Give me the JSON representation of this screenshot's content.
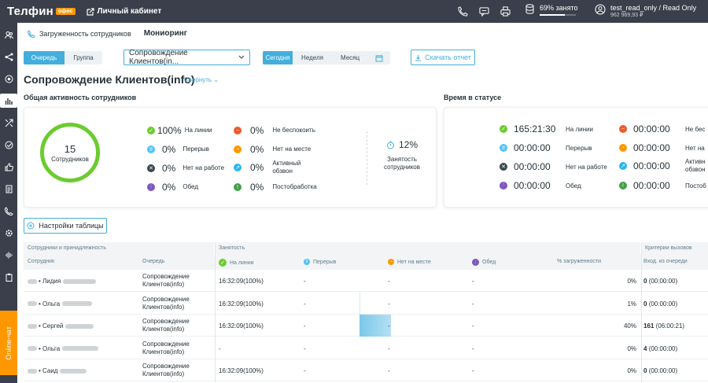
{
  "colors": {
    "accent": "#43aedc",
    "green": "#6ccb2f",
    "orange": "#ff9800",
    "red": "#f0592a",
    "topbar": "#3a3f4b"
  },
  "topbar": {
    "logo": "Телфин",
    "logo_badge": "офис",
    "cabinet_label": "Личный кабинет",
    "load_label": "69% занято",
    "load_fraction": 0.69,
    "user_name": "test_read_only / Read Only",
    "user_balance": "962 969,93 ₽",
    "icons": [
      "phone-icon",
      "chat-icon",
      "printer-icon",
      "database-icon",
      "user-circle-icon"
    ]
  },
  "sidebar": {
    "icons": [
      "users-icon",
      "flow-icon",
      "target-icon",
      "chart-icon",
      "routes-icon",
      "check-circle-icon",
      "thumb-icon",
      "document-icon",
      "phone-call-icon",
      "settings-icon",
      "waveform-icon",
      "clipboard-icon"
    ],
    "online_chat": "Online-чат"
  },
  "subnav": {
    "item1": "Загруженность сотрудников",
    "item2": "Мониоринг"
  },
  "filters": {
    "queue_tab": "Очередь",
    "group_tab": "Группа",
    "select_value": "Сопровождение Клиентов(in...",
    "today": "Сегодня",
    "week": "Неделя",
    "month": "Месяц",
    "download": "Скачать отчет"
  },
  "page": {
    "title": "Сопровождение Клиентов(info)",
    "collapse": "Свернуть"
  },
  "activity": {
    "title": "Общая активность сотрудников",
    "count": "15",
    "count_label": "Сотрудников",
    "stats": [
      {
        "pct": "100%",
        "label": "На линии"
      },
      {
        "pct": "0%",
        "label": "Перерыв"
      },
      {
        "pct": "0%",
        "label": "Нет на работе"
      },
      {
        "pct": "0%",
        "label": "Обед"
      },
      {
        "pct": "0%",
        "label": "Не беспокоить"
      },
      {
        "pct": "0%",
        "label": "Нет на месте"
      },
      {
        "pct": "0%",
        "label": "Активный обзвон"
      },
      {
        "pct": "0%",
        "label": "Постобработка"
      }
    ],
    "utilization": "12%",
    "utilization_label": "Занятость сотрудников"
  },
  "time_status": {
    "title": "Время в статусе",
    "rows": [
      {
        "value": "165:21:30",
        "label": "На линии"
      },
      {
        "value": "00:00:00",
        "label": "Перерыв"
      },
      {
        "value": "00:00:00",
        "label": "Нет на работе"
      },
      {
        "value": "00:00:00",
        "label": "Обед"
      }
    ],
    "rows2": [
      {
        "value": "00:00:00",
        "label": "Не бес"
      },
      {
        "value": "00:00:00",
        "label": "Нет на"
      },
      {
        "value": "00:00:00",
        "label": "Активн обзвон"
      },
      {
        "value": "00:00:00",
        "label": "Постоб"
      }
    ]
  },
  "table": {
    "settings_button": "Настройки таблицы",
    "groups": [
      "Сотрудники и принадлежность",
      "Занятость",
      "Критерии вызовов"
    ],
    "headers": [
      "Сотрудник",
      "Очередь",
      "На линии",
      "Перерыв",
      "Нет на месте",
      "Обед",
      "% загруженности",
      "Вход. из очереди"
    ],
    "rows": [
      {
        "name": "• Лидия",
        "queue": "Сопровождение Клиентов(info)",
        "online": "16:32:09(100%)",
        "pause": "-",
        "away": "-",
        "lunch": "-",
        "load": "0%",
        "load_fraction": 0,
        "incoming_count": "0",
        "incoming_time": "(00:00:00)"
      },
      {
        "name": "• Ольга",
        "queue": "Сопровождение Клиентов(info)",
        "online": "16:32:09(100%)",
        "pause": "-",
        "away": "-",
        "lunch": "-",
        "load": "1%",
        "load_fraction": 0.01,
        "incoming_count": "0",
        "incoming_time": "(00:00:00)"
      },
      {
        "name": "• Сергей",
        "queue": "Сопровождение Клиентов(info)",
        "online": "16:32:09(100%)",
        "pause": "-",
        "away": "-",
        "lunch": "-",
        "load": "40%",
        "load_fraction": 0.4,
        "incoming_count": "161",
        "incoming_time": "(06:00:21)"
      },
      {
        "name": "• Ольга",
        "queue": "Сопровождение Клиентов(info)",
        "online": "-",
        "pause": "-",
        "away": "-",
        "lunch": "-",
        "load": "0%",
        "load_fraction": 0,
        "incoming_count": "4",
        "incoming_time": "(00:00:00)"
      },
      {
        "name": "• Саид",
        "queue": "Сопровождение Клиентов(info)",
        "online": "16:32:09(100%)",
        "pause": "-",
        "away": "-",
        "lunch": "-",
        "load": "0%",
        "load_fraction": 0,
        "incoming_count": "0",
        "incoming_time": "(00:00:00)"
      }
    ]
  }
}
